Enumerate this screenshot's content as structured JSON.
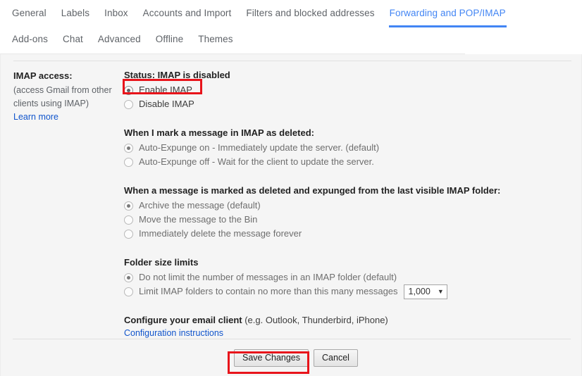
{
  "tabs": {
    "row1": [
      {
        "label": "General",
        "active": false
      },
      {
        "label": "Labels",
        "active": false
      },
      {
        "label": "Inbox",
        "active": false
      },
      {
        "label": "Accounts and Import",
        "active": false
      },
      {
        "label": "Filters and blocked addresses",
        "active": false
      },
      {
        "label": "Forwarding and POP/IMAP",
        "active": true
      }
    ],
    "row2": [
      {
        "label": "Add-ons",
        "active": false
      },
      {
        "label": "Chat",
        "active": false
      },
      {
        "label": "Advanced",
        "active": false
      },
      {
        "label": "Offline",
        "active": false
      },
      {
        "label": "Themes",
        "active": false
      }
    ],
    "active_color": "#4285f4",
    "inactive_color": "#5f6368"
  },
  "imap_section": {
    "left_label": "IMAP access:",
    "left_sub_line1": "(access Gmail from other",
    "left_sub_line2": "clients using IMAP)",
    "learn_more": "Learn more",
    "status": "Status: IMAP is disabled",
    "options": [
      {
        "label": "Enable IMAP",
        "checked": true
      },
      {
        "label": "Disable IMAP",
        "checked": false
      }
    ]
  },
  "expunge_section": {
    "heading": "When I mark a message in IMAP as deleted:",
    "options": [
      {
        "label": "Auto-Expunge on - Immediately update the server. (default)",
        "checked": true
      },
      {
        "label": "Auto-Expunge off - Wait for the client to update the server.",
        "checked": false
      }
    ]
  },
  "deleted_section": {
    "heading": "When a message is marked as deleted and expunged from the last visible IMAP folder:",
    "options": [
      {
        "label": "Archive the message (default)",
        "checked": true
      },
      {
        "label": "Move the message to the Bin",
        "checked": false
      },
      {
        "label": "Immediately delete the message forever",
        "checked": false
      }
    ]
  },
  "folder_size_section": {
    "heading": "Folder size limits",
    "options": [
      {
        "label": "Do not limit the number of messages in an IMAP folder (default)",
        "checked": true
      },
      {
        "label": "Limit IMAP folders to contain no more than this many messages",
        "checked": false
      }
    ],
    "limit_select": {
      "value": "1,000",
      "caret": "▼"
    }
  },
  "configure_section": {
    "heading_bold": "Configure your email client",
    "heading_normal": " (e.g. Outlook, Thunderbird, iPhone)",
    "link": "Configuration instructions"
  },
  "footer": {
    "save_label": "Save Changes",
    "cancel_label": "Cancel"
  },
  "highlights": {
    "color": "#e8141b",
    "targets": [
      "Enable IMAP",
      "Save Changes"
    ]
  }
}
